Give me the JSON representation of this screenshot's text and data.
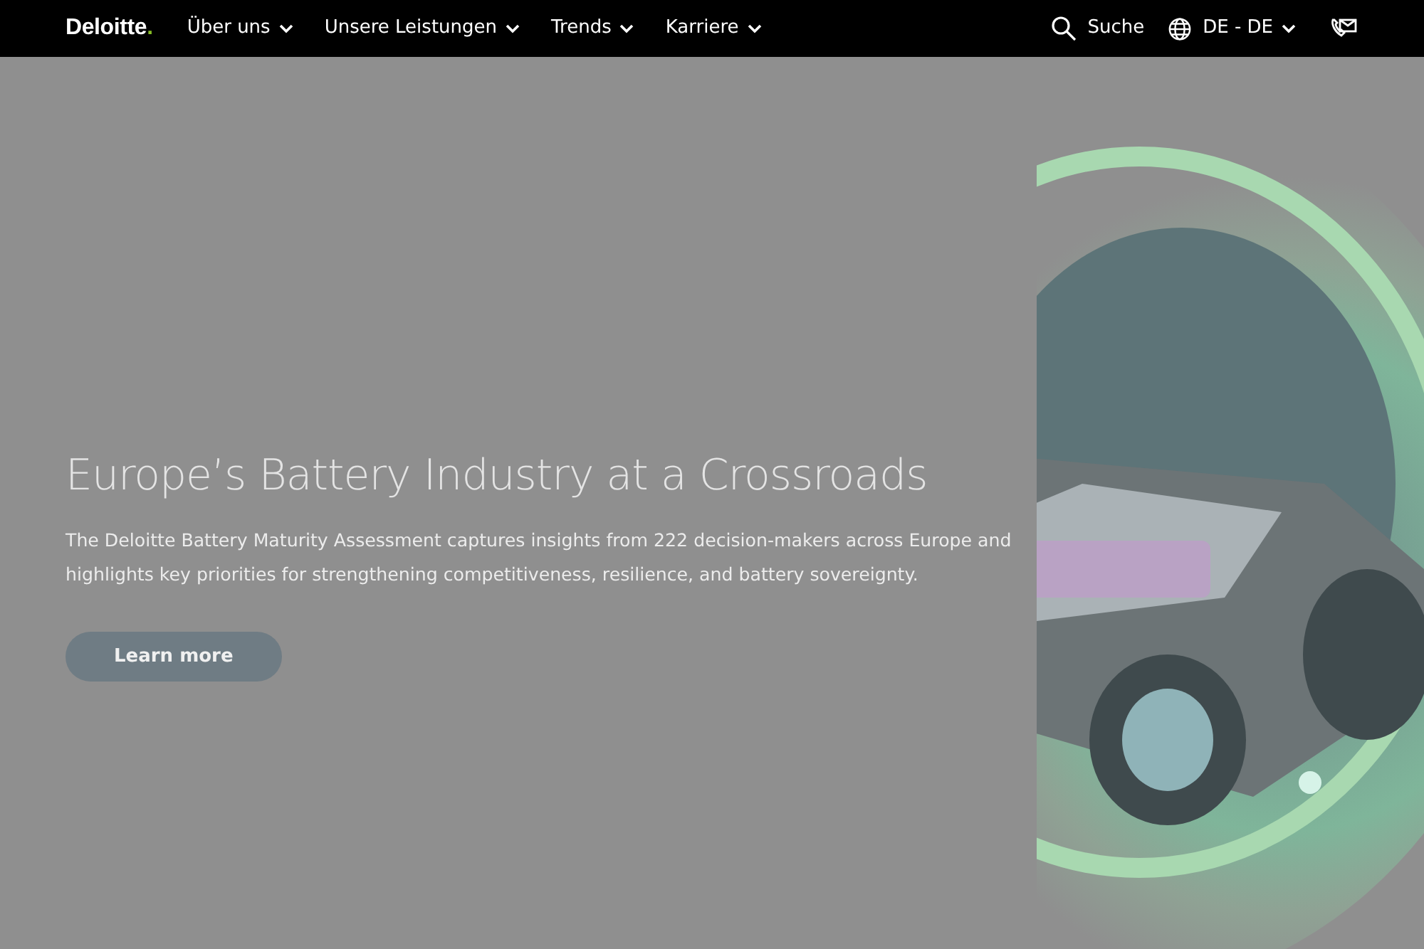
{
  "header": {
    "logo": {
      "text": "Deloitte",
      "dot": "."
    },
    "nav_items": [
      {
        "label": "Über uns"
      },
      {
        "label": "Unsere Leistungen"
      },
      {
        "label": "Trends"
      },
      {
        "label": "Karriere"
      }
    ],
    "search": {
      "label": "Suche"
    },
    "language": {
      "label": "DE - DE"
    }
  },
  "hero": {
    "title": "Europe’s Battery Industry at a Crossroads",
    "text": "The Deloitte Battery Maturity Assessment captures insights from 222 decision-makers across Europe and highlights key priorities for strengthening competitiveness, resilience, and battery sovereignty.",
    "button": "Learn more"
  }
}
